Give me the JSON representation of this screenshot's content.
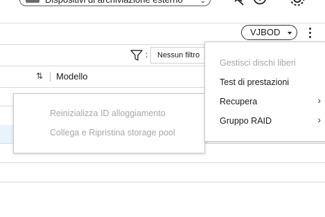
{
  "header": {
    "storage_select_label": "Dispositivi di archiviazione esterno",
    "icons": [
      "disk-icon",
      "chevron-down-icon",
      "no-wifi-icon",
      "info-icon",
      "gear-icon"
    ]
  },
  "toolbar": {
    "vjbod_label": "VJBOD",
    "filter_colon": ":",
    "filter_value": "Nessun filtro"
  },
  "table": {
    "columns": [
      "Modello"
    ]
  },
  "context_menu": {
    "items": [
      {
        "label": "Gestisci dischi liberi",
        "enabled": false,
        "submenu": false
      },
      {
        "label": "Test di prestazioni",
        "enabled": true,
        "submenu": false
      },
      {
        "label": "Recupera",
        "enabled": true,
        "submenu": true
      },
      {
        "label": "Gruppo RAID",
        "enabled": true,
        "submenu": true
      }
    ]
  },
  "submenu": {
    "items": [
      {
        "label": "Reinizializza ID alloggiamento",
        "enabled": false
      },
      {
        "label": "Collega e Ripristina storage pool",
        "enabled": false
      }
    ]
  },
  "colors": {
    "selected_row": "#e8f4fb",
    "disabled_text": "#a7a7a7"
  }
}
